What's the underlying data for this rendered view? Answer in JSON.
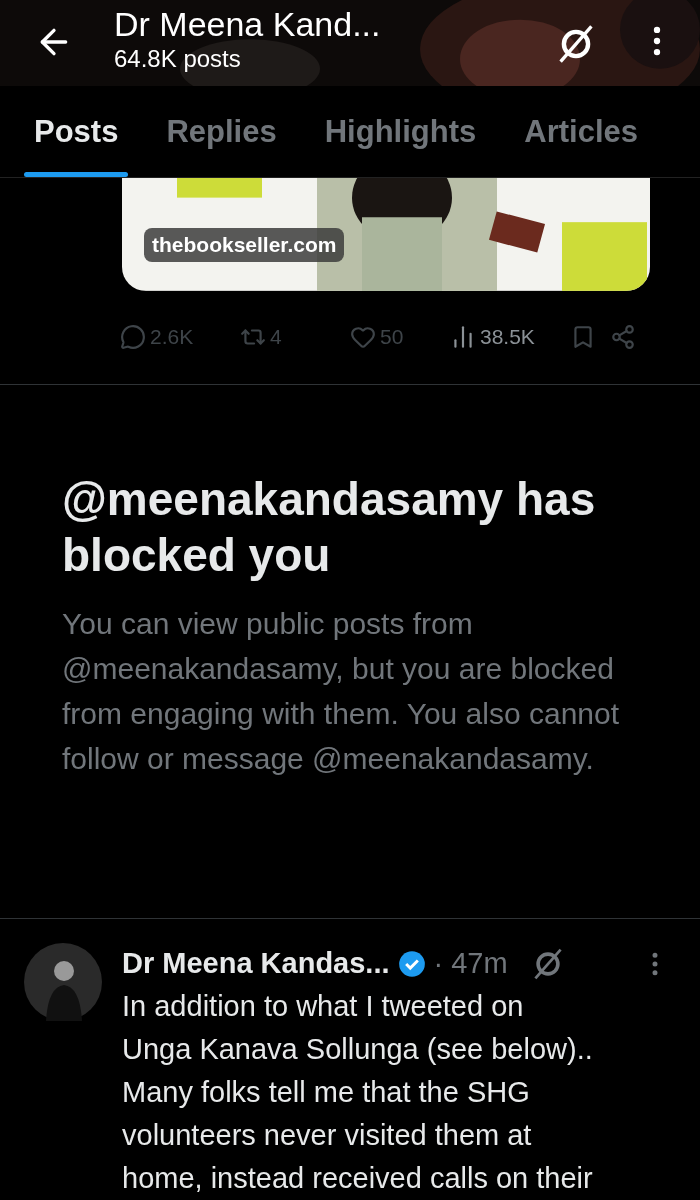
{
  "header": {
    "title": "Dr Meena Kand...",
    "subtitle": "64.8K posts"
  },
  "tabs": [
    {
      "label": "Posts",
      "selected": true
    },
    {
      "label": "Replies",
      "selected": false
    },
    {
      "label": "Highlights",
      "selected": false
    },
    {
      "label": "Articles",
      "selected": false
    }
  ],
  "media_card": {
    "kind": "picture",
    "source_label": "thebookseller.com"
  },
  "actions": [
    {
      "kind": "reply",
      "count": "2.6K"
    },
    {
      "kind": "repost",
      "count": "4"
    },
    {
      "kind": "like",
      "count": "50"
    },
    {
      "kind": "views",
      "count": "38.5K"
    },
    {
      "kind": "bookmark"
    },
    {
      "kind": "share"
    }
  ],
  "blocked_notice": {
    "title": "@meenakandasamy has blocked you",
    "body": "You can view public posts from @meenakandasamy, but you are blocked from engaging with them. You also cannot follow or message @meenakandasamy."
  },
  "tweet": {
    "author": "Dr Meena Kandas...",
    "verified": true,
    "time": "· 47m",
    "text_lines": [
      "In addition to what I tweeted on",
      "Unga Kanava Sollunga (see below)..",
      "Many folks tell me that the SHG",
      "volunteers never visited them at",
      "home, instead received calls on their"
    ]
  }
}
